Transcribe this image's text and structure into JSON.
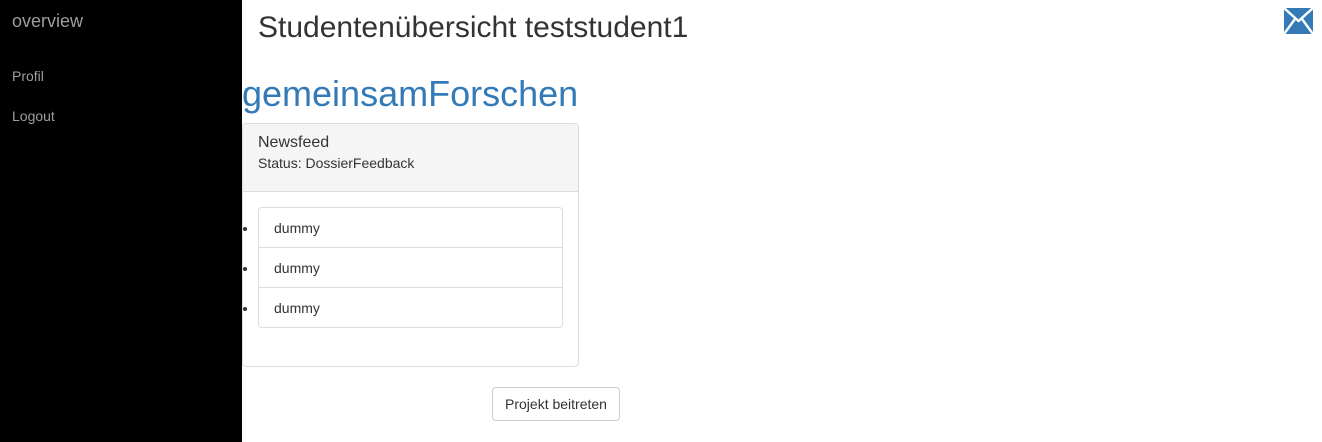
{
  "sidebar": {
    "brand": "overview",
    "items": [
      {
        "label": "Profil"
      },
      {
        "label": "Logout"
      }
    ]
  },
  "header": {
    "title": "Studentenübersicht teststudent1",
    "mail_icon": "envelope-icon"
  },
  "project": {
    "name": "gemeinsamForschen",
    "panel": {
      "title": "Newsfeed",
      "status": "Status: DossierFeedback",
      "items": [
        "dummy",
        "dummy",
        "dummy"
      ]
    },
    "join_button": "Projekt beitreten"
  },
  "colors": {
    "sidebar_bg": "#000000",
    "sidebar_text": "#9d9d9d",
    "link": "#337ab7",
    "icon": "#337ab7",
    "panel_heading_bg": "#f5f5f5",
    "border": "#dddddd"
  }
}
